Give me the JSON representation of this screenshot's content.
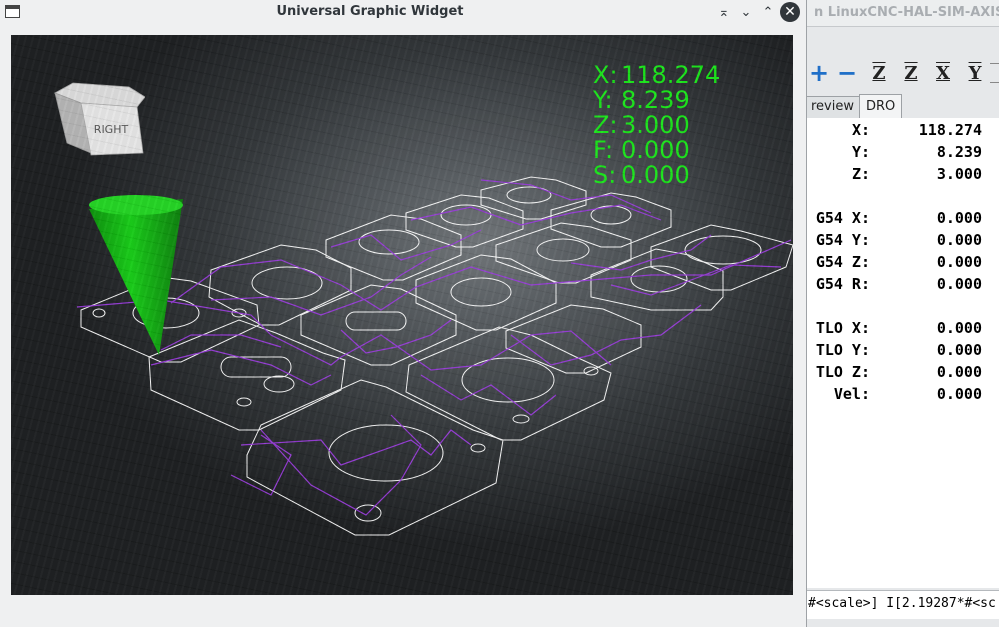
{
  "background_window": {
    "title": "n LinuxCNC-HAL-SIM-AXIS",
    "toolbar": [
      {
        "icon": "zoom-in-icon",
        "glyph": "+"
      },
      {
        "icon": "zoom-out-icon",
        "glyph": "−"
      },
      {
        "icon": "view-z-icon",
        "glyph": "Z"
      },
      {
        "icon": "view-z-rotated-icon",
        "glyph": "Z"
      },
      {
        "icon": "view-x-icon",
        "glyph": "X"
      },
      {
        "icon": "view-y-icon",
        "glyph": "Y"
      }
    ],
    "tabs": [
      {
        "label": "review",
        "active": false
      },
      {
        "label": "DRO",
        "active": true
      }
    ],
    "dro": [
      {
        "label": "X:",
        "value": "118.274"
      },
      {
        "label": "Y:",
        "value": "8.239"
      },
      {
        "label": "Z:",
        "value": "3.000"
      },
      {
        "label": "",
        "value": ""
      },
      {
        "label": "G54 X:",
        "value": "0.000"
      },
      {
        "label": "G54 Y:",
        "value": "0.000"
      },
      {
        "label": "G54 Z:",
        "value": "0.000"
      },
      {
        "label": "G54 R:",
        "value": "0.000"
      },
      {
        "label": "",
        "value": ""
      },
      {
        "label": "TLO X:",
        "value": "0.000"
      },
      {
        "label": "TLO Y:",
        "value": "0.000"
      },
      {
        "label": "TLO Z:",
        "value": "0.000"
      },
      {
        "label": "Vel:",
        "value": "0.000"
      }
    ],
    "mdi_text": "#<scale>] I[2.19287*#<sc"
  },
  "dialog": {
    "title": "Universal Graphic Widget",
    "controls": {
      "keep_above": "⌅",
      "minimize": "⌄",
      "maximize": "⌃",
      "close": "✕"
    },
    "view_cube_label": "RIGHT",
    "dro_overlay": [
      {
        "axis": "X:",
        "value": "118.274"
      },
      {
        "axis": "Y:",
        "value": "8.239"
      },
      {
        "axis": "Z:",
        "value": "3.000"
      },
      {
        "axis": "F:",
        "value": "0.000"
      },
      {
        "axis": "S:",
        "value": "0.000"
      }
    ],
    "colors": {
      "overlay_text": "#19e619",
      "tool_cone": "#11bb11",
      "feed_path": "#ffffff",
      "rapid_path": "#9a3bdd"
    }
  }
}
